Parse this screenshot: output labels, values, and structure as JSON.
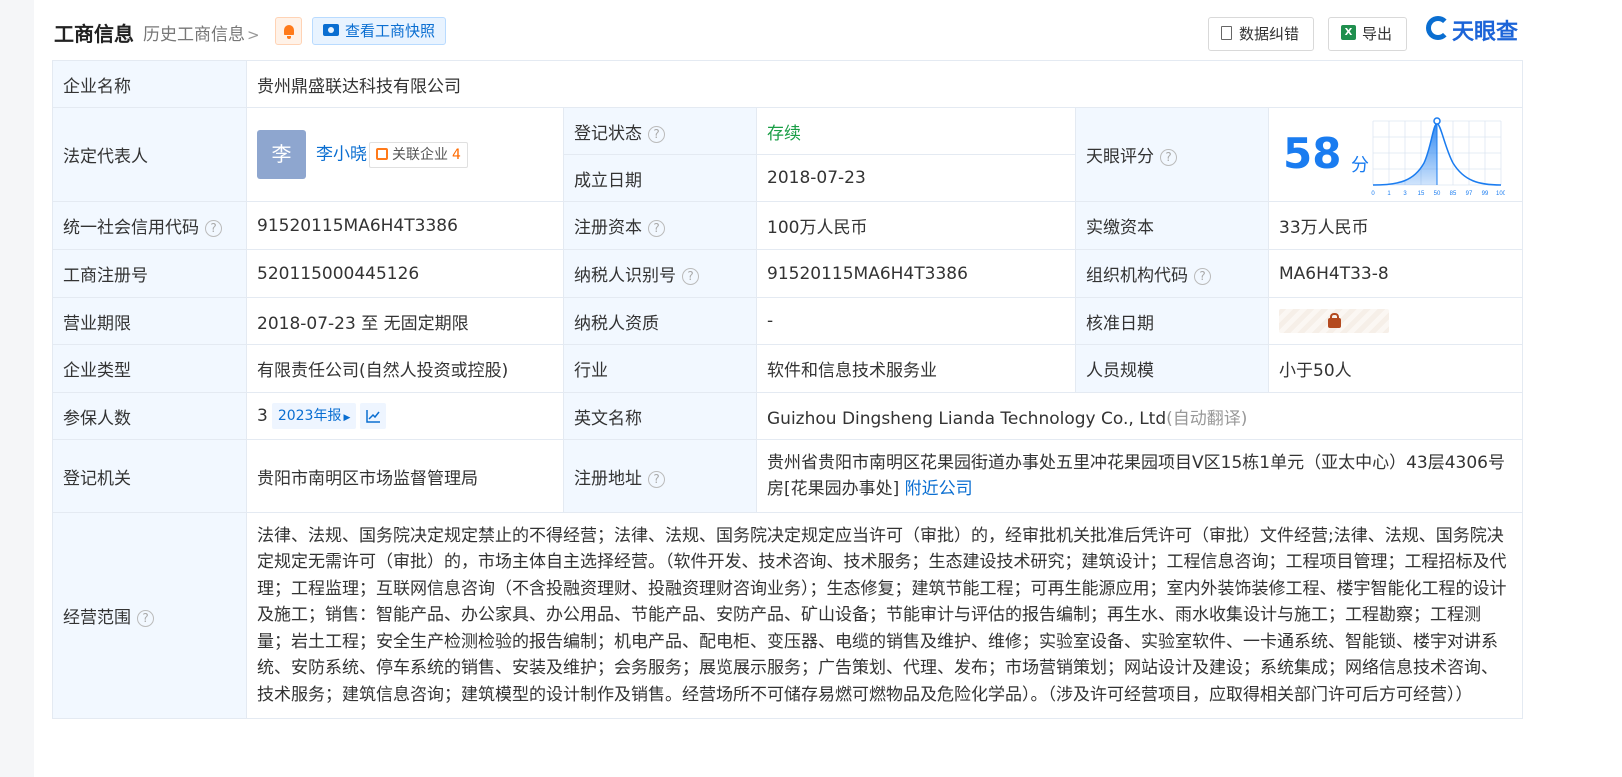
{
  "header": {
    "title": "工商信息",
    "history_link": "历史工商信息",
    "snapshot_button": "查看工商快照",
    "report_button": "数据纠错",
    "export_button": "导出",
    "logo_text": "天眼查"
  },
  "labels": {
    "company_name": "企业名称",
    "legal_rep": "法定代表人",
    "reg_status": "登记状态",
    "est_date": "成立日期",
    "tianyan_score": "天眼评分",
    "credit_code": "统一社会信用代码",
    "reg_capital": "注册资本",
    "paid_capital": "实缴资本",
    "biz_reg_no": "工商注册号",
    "taxpayer_id": "纳税人识别号",
    "org_code": "组织机构代码",
    "biz_term": "营业期限",
    "taxpayer_qual": "纳税人资质",
    "approval_date": "核准日期",
    "company_type": "企业类型",
    "industry": "行业",
    "staff_size": "人员规模",
    "insured_count": "参保人数",
    "english_name": "英文名称",
    "reg_authority": "登记机关",
    "reg_address": "注册地址",
    "biz_scope": "经营范围"
  },
  "values": {
    "company_name": "贵州鼎盛联达科技有限公司",
    "legal_rep_avatar": "李",
    "legal_rep_name": "李小晓",
    "related_label": "关联企业",
    "related_count": "4",
    "reg_status": "存续",
    "est_date": "2018-07-23",
    "score": "58",
    "score_unit": "分",
    "credit_code": "91520115MA6H4T3386",
    "reg_capital": "100万人民币",
    "paid_capital": "33万人民币",
    "biz_reg_no": "520115000445126",
    "taxpayer_id": "91520115MA6H4T3386",
    "org_code": "MA6H4T33-8",
    "biz_term": "2018-07-23 至 无固定期限",
    "taxpayer_qual": "-",
    "company_type": "有限责任公司(自然人投资或控股)",
    "industry": "软件和信息技术服务业",
    "staff_size": "小于50人",
    "insured_count": "3",
    "annual_report_tag": "2023年报",
    "english_name": "Guizhou Dingsheng Lianda Technology Co., Ltd",
    "auto_translate": "(自动翻译)",
    "reg_authority": "贵阳市南明区市场监督管理局",
    "reg_address": "贵州省贵阳市南明区花果园街道办事处五里冲花果园项目V区15栋1单元（亚太中心）43层4306号房[花果园办事处]",
    "nearby_link": "附近公司",
    "biz_scope": "法律、法规、国务院决定规定禁止的不得经营；法律、法规、国务院决定规定应当许可（审批）的，经审批机关批准后凭许可（审批）文件经营;法律、法规、国务院决定规定无需许可（审批）的，市场主体自主选择经营。（软件开发、技术咨询、技术服务；生态建设技术研究；建筑设计；工程信息咨询；工程项目管理；工程招标及代理；工程监理；互联网信息咨询（不含投融资理财、投融资理财咨询业务）；生态修复；建筑节能工程；可再生能源应用；室内外装饰装修工程、楼宇智能化工程的设计及施工；销售：智能产品、办公家具、办公用品、节能产品、安防产品、矿山设备；节能审计与评估的报告编制；再生水、雨水收集设计与施工；工程勘察；工程测量；岩土工程；安全生产检测检验的报告编制；机电产品、配电柜、变压器、电缆的销售及维护、维修；实验室设备、实验室软件、一卡通系统、智能锁、楼宇对讲系统、安防系统、停车系统的销售、安装及维护；会务服务；展览展示服务；广告策划、代理、发布；市场营销策划；网站设计及建设；系统集成；网络信息技术咨询、技术服务；建筑信息咨询；建筑模型的设计制作及销售。经营场所不可储存易燃可燃物品及危险化学品）。（涉及许可经营项目，应取得相关部门许可后方可经营））"
  },
  "score_chart": {
    "x_ticks": [
      "0",
      "1",
      "3",
      "15",
      "50",
      "85",
      "97",
      "99",
      "100"
    ],
    "marker_index": 4
  },
  "colors": {
    "accent": "#0a6ed1",
    "label_bg": "#f2f8ff",
    "status_green": "#1a9e46",
    "score_blue": "#1a7cf0"
  }
}
